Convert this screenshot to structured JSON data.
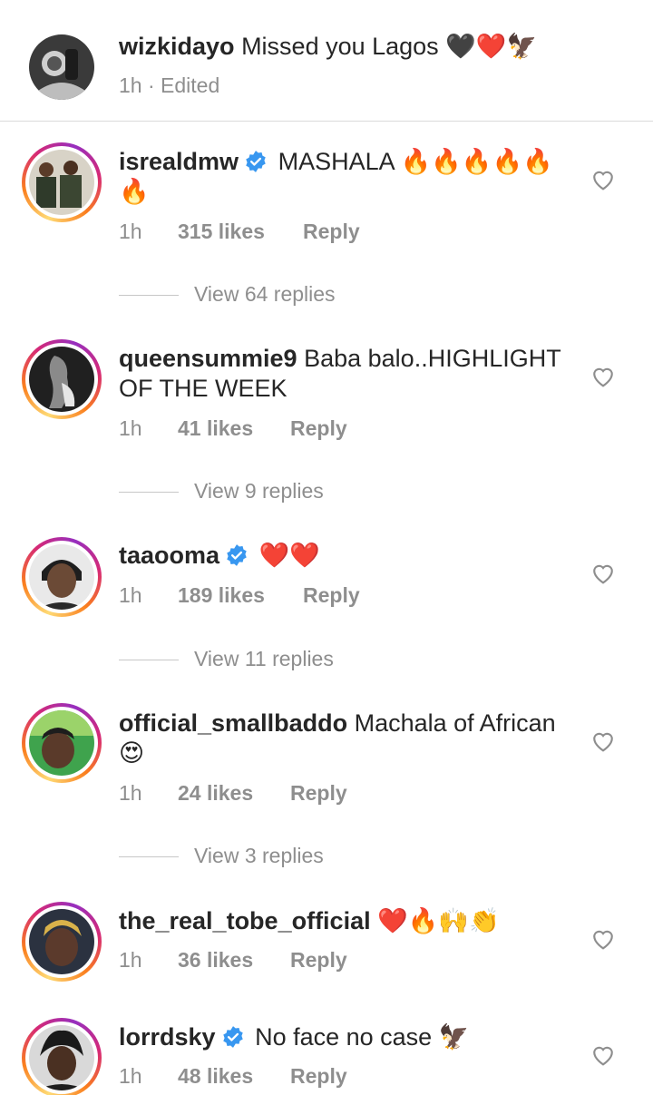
{
  "caption": {
    "username": "wizkidayo",
    "text": "Missed you Lagos",
    "emojis": "🖤❤️🦅",
    "time": "1h",
    "separator": "·",
    "edited": "Edited"
  },
  "comments": [
    {
      "username": "isrealdmw",
      "verified": true,
      "text": "MASHALA",
      "emojis": "🔥🔥🔥🔥🔥 🔥",
      "time": "1h",
      "likes": "315 likes",
      "reply": "Reply",
      "view_replies": "View 64 replies"
    },
    {
      "username": "queensummie9",
      "verified": false,
      "text": "Baba balo..HIGHLIGHT OF THE WEEK",
      "emojis": "",
      "time": "1h",
      "likes": "41 likes",
      "reply": "Reply",
      "view_replies": "View 9 replies"
    },
    {
      "username": "taaooma",
      "verified": true,
      "text": "",
      "emojis": "❤️❤️",
      "time": "1h",
      "likes": "189 likes",
      "reply": "Reply",
      "view_replies": "View 11 replies"
    },
    {
      "username": "official_smallbaddo",
      "verified": false,
      "text": "Machala of African",
      "emojis": "😍",
      "time": "1h",
      "likes": "24 likes",
      "reply": "Reply",
      "view_replies": "View 3 replies"
    },
    {
      "username": "the_real_tobe_official",
      "verified": false,
      "text": "",
      "emojis": "❤️🔥🙌👏",
      "time": "1h",
      "likes": "36 likes",
      "reply": "Reply",
      "view_replies": ""
    },
    {
      "username": "lorrdsky",
      "verified": true,
      "text": "No face no case",
      "emojis": "🦅",
      "time": "1h",
      "likes": "48 likes",
      "reply": "Reply",
      "view_replies": ""
    }
  ],
  "colors": {
    "text": "#262626",
    "meta": "#8e8e8e",
    "verified": "#3897f0",
    "divider": "#dbdbdb"
  },
  "icons": {
    "like": "heart-outline-icon",
    "verified": "verified-badge-icon"
  }
}
